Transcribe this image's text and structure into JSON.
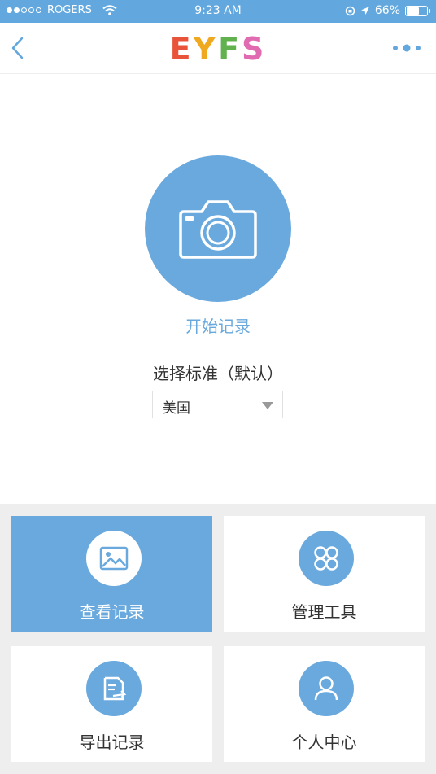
{
  "status_bar": {
    "carrier": "ROGERS",
    "time": "9:23 AM",
    "battery": "66%",
    "battery_level": 0.66,
    "signal_bars": 2,
    "signal_total": 5
  },
  "nav": {
    "logo_letters": [
      {
        "char": "E",
        "color": "#e8533a"
      },
      {
        "char": "Y",
        "color": "#f0a81f"
      },
      {
        "char": "F",
        "color": "#61b14e"
      },
      {
        "char": "S",
        "color": "#e06bb0"
      }
    ],
    "accent": "#62a8de",
    "back_icon": "chevron-left-icon",
    "more_icon": "more-dots-icon"
  },
  "main": {
    "start_label": "开始记录",
    "standard_label": "选择标准（默认）",
    "standard_select": {
      "value": "美国"
    },
    "camera_icon": "camera-icon"
  },
  "tiles": [
    {
      "label": "查看记录",
      "icon": "image-icon",
      "active": true
    },
    {
      "label": "管理工具",
      "icon": "tools-icon",
      "active": false
    },
    {
      "label": "导出记录",
      "icon": "export-icon",
      "active": false
    },
    {
      "label": "个人中心",
      "icon": "user-icon",
      "active": false
    }
  ],
  "colors": {
    "primary": "#6aa9dd",
    "background": "#eeeeee"
  }
}
